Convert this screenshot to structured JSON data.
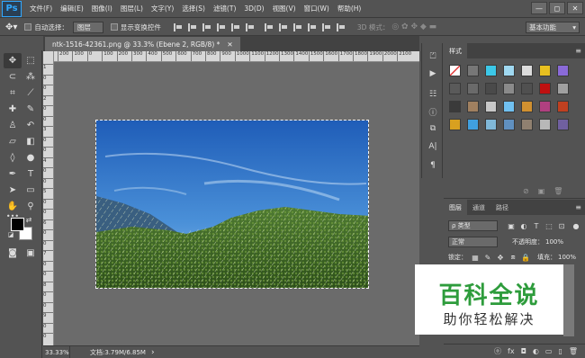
{
  "app": {
    "logo": "Ps"
  },
  "menu": [
    "文件(F)",
    "编辑(E)",
    "图像(I)",
    "图层(L)",
    "文字(Y)",
    "选择(S)",
    "滤镜(T)",
    "3D(D)",
    "视图(V)",
    "窗口(W)",
    "帮助(H)"
  ],
  "window_controls": {
    "minimize": "—",
    "restore": "◻",
    "close": "✕"
  },
  "options_bar": {
    "auto_select_label": "自动选择：",
    "auto_select_value": "图层",
    "show_transform_label": "显示变换控件",
    "mode_3d_label": "3D 模式：",
    "workspace": "基本功能"
  },
  "document": {
    "tab_title": "ntk-1516-42361.png @ 33.3% (Ebene 2, RGB/8) *",
    "tab_close": "✕"
  },
  "ruler": {
    "h_ticks": [
      "200",
      "100",
      "0",
      "100",
      "200",
      "300",
      "400",
      "500",
      "600",
      "700",
      "800",
      "900",
      "1000",
      "1100",
      "1200",
      "1300",
      "1400",
      "1500",
      "1600",
      "1700",
      "1800",
      "1900",
      "2000",
      "2100"
    ],
    "v_ticks": [
      "1",
      "0",
      "0",
      "2",
      "0",
      "0",
      "3",
      "0",
      "0",
      "4",
      "0",
      "0",
      "5",
      "0",
      "0",
      "6",
      "0",
      "0",
      "7",
      "0",
      "0",
      "8",
      "0",
      "0",
      "9",
      "0",
      "0"
    ]
  },
  "status_bar": {
    "zoom": "33.33%",
    "doc_info": "文档:3.79M/6.85M",
    "arrow": "›"
  },
  "styles_panel": {
    "tab": "样式",
    "swatches": [
      "#ffffff",
      "#777777",
      "#3cc8e8",
      "#9fd8f0",
      "#dcdcdc",
      "#e8c020",
      "#8a6ad8",
      "#5a5a5a",
      "#6a6a6a",
      "#4a4a4a",
      "#8a8a8a",
      "#505050",
      "#c01010",
      "#a0a0a0",
      "#3a3a3a",
      "#a08060",
      "#c8c8c8",
      "#70c0f0",
      "#d09030",
      "#b04080",
      "#c04020",
      "#d8a020",
      "#40a0e0",
      "#80b8d8",
      "#6090c0",
      "#908070",
      "#b8b8b8",
      "#7060a0"
    ]
  },
  "layers_panel": {
    "tabs": [
      "图层",
      "通道",
      "路径"
    ],
    "filter_label": "ρ 类型",
    "blend_mode": "正常",
    "opacity_label": "不透明度：",
    "opacity_value": "100%",
    "lock_label": "锁定：",
    "fill_label": "填充：",
    "fill_value": "100%",
    "bottom_icons": [
      "ⓞ",
      "fx",
      "◘",
      "◐",
      "▭",
      "▯",
      "🗑"
    ]
  },
  "watermark": {
    "title": "百科全说",
    "subtitle": "助你轻松解决"
  }
}
